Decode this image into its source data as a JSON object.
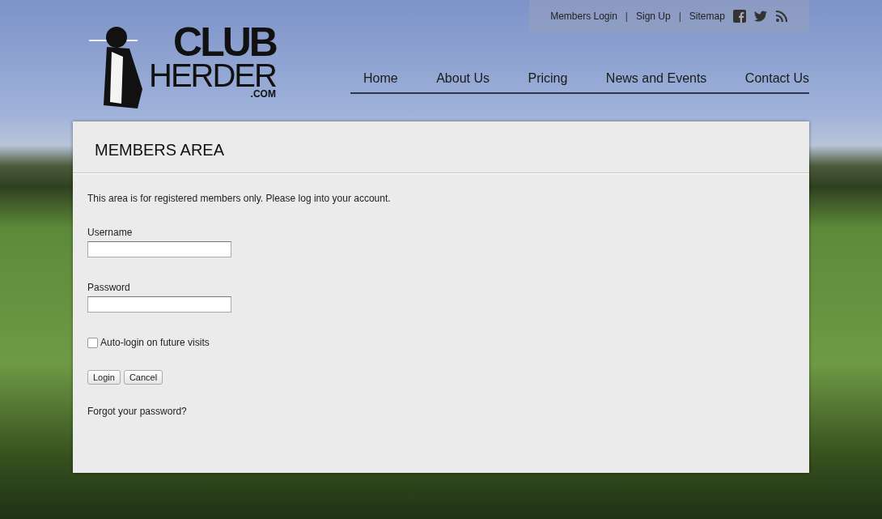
{
  "logo": {
    "line_1": "CLUB",
    "line_2": "HERDER",
    "line_3": ".COM"
  },
  "top_links": [
    "Members Login",
    "Sign Up",
    "Sitemap"
  ],
  "top_separator": "|",
  "nav": [
    "Home",
    "About Us",
    "Pricing",
    "News and Events",
    "Contact Us"
  ],
  "panel": {
    "title": "MEMBERS AREA",
    "intro": "This area is for registered members only. Please log into your account.",
    "fields": [
      {
        "label": "Username"
      },
      {
        "label": "Password"
      }
    ],
    "auto_login": {
      "label": "Auto-login on future visits",
      "checked": false
    },
    "buttons": [
      "Login",
      "Cancel"
    ],
    "forgot_link": "Forgot your password?"
  }
}
